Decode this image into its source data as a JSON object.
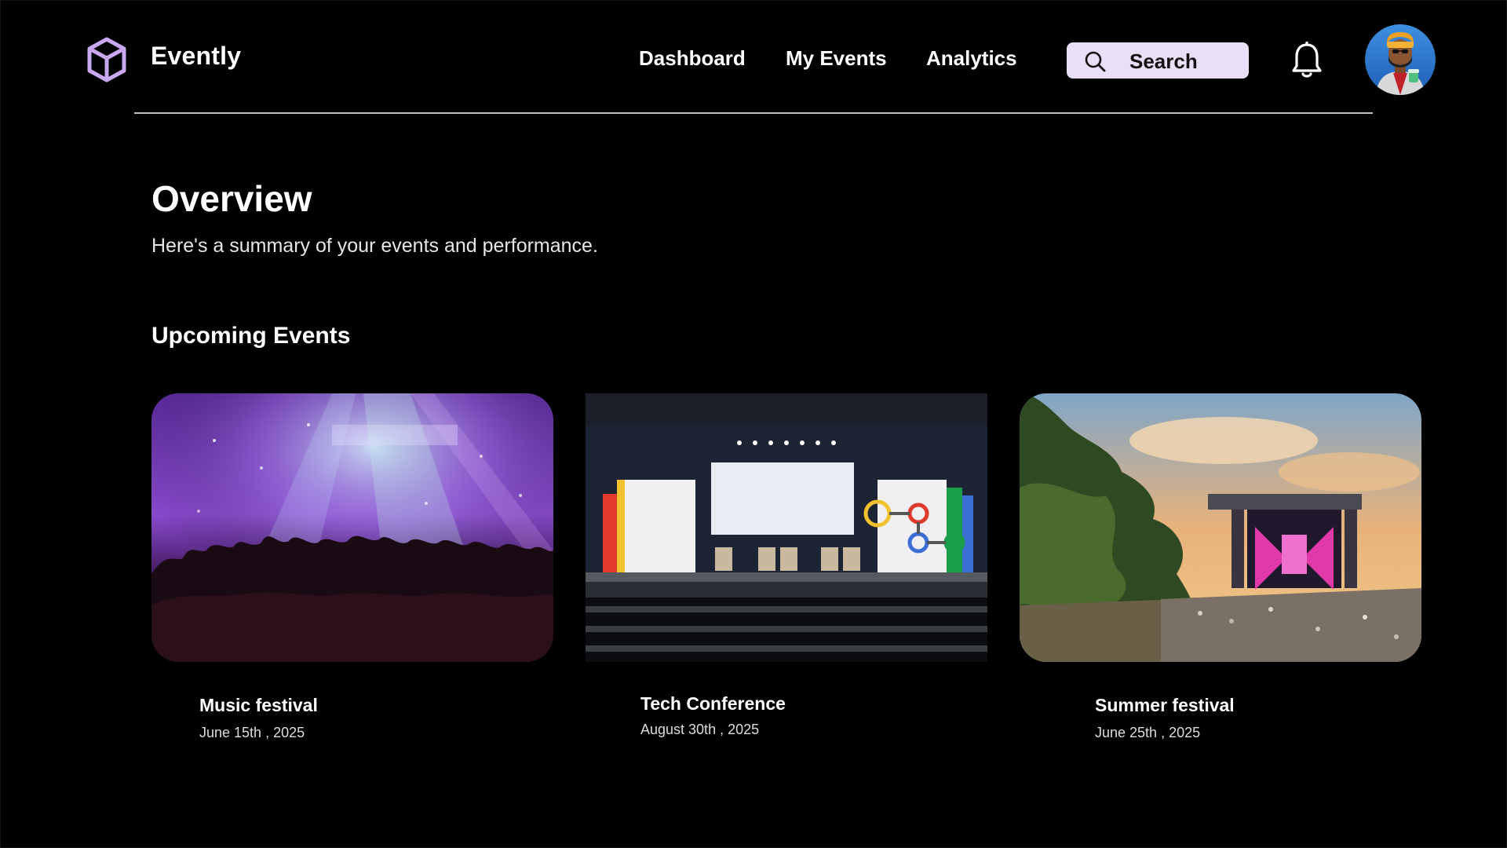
{
  "app": {
    "name": "Evently",
    "logo_icon": "cube-icon",
    "accent_color": "#c9a8f2"
  },
  "nav": {
    "items": [
      {
        "label": "Dashboard"
      },
      {
        "label": "My Events"
      },
      {
        "label": "Analytics"
      }
    ]
  },
  "search": {
    "label": "Search",
    "icon": "search-icon",
    "background": "#eadff8"
  },
  "header_icons": {
    "notifications": "bell-icon",
    "profile": "avatar"
  },
  "overview": {
    "title": "Overview",
    "subtitle": "Here's a summary of your events and performance."
  },
  "upcoming": {
    "title": "Upcoming Events",
    "events": [
      {
        "name": "Music festival",
        "date": "June 15th , 2025",
        "image": "concert-crowd-photo"
      },
      {
        "name": "Tech Conference",
        "date": "August 30th , 2025",
        "image": "conference-stage-photo"
      },
      {
        "name": "Summer festival",
        "date": "June 25th , 2025",
        "image": "outdoor-festival-photo"
      }
    ]
  }
}
